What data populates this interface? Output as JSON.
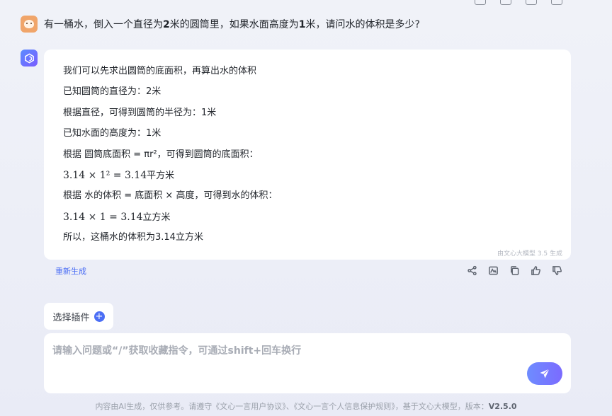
{
  "question": {
    "pre": "有一桶水，倒入一个直径为",
    "n1": "2",
    "mid": "米的圆筒里，如果水面高度为",
    "n2": "1",
    "post": "米，请问水的体积是多少?"
  },
  "answer": {
    "line1": "我们可以先求出圆筒的底面积，再算出水的体积",
    "line2": "已知圆筒的直径为：2米",
    "line3": "根据直径，可得到圆筒的半径为：1米",
    "line4": "已知水面的高度为：1米",
    "line5": "根据 圆筒底面积 = πr²，可得到圆筒的底面积：",
    "formula1": "3.14 × 1² = 3.14",
    "formula1_unit": "平方米",
    "line6": "根据 水的体积 = 底面积 × 高度，可得到水的体积：",
    "formula2": "3.14 × 1 = 3.14",
    "formula2_unit": "立方米",
    "line7": "所以，这桶水的体积为3.14立方米",
    "watermark": "由文心大模型 3.5 生成"
  },
  "regenerate_label": "重新生成",
  "icons": [
    "share-icon",
    "image-icon",
    "copy-icon",
    "thumbs-up-icon",
    "thumbs-down-icon"
  ],
  "plugin_label": "选择插件",
  "input_placeholder": "请输入问题或“/”获取收藏指令，可通过shift+回车换行",
  "footer": {
    "text": "内容由AI生成，仅供参考。请遵守《文心一言用户协议》、《文心一言个人信息保护规则》，基于文心大模型，版本：",
    "version": "V2.5.0"
  },
  "colors": {
    "accent": "#4b6ef5",
    "send_button": "#7b6bff",
    "background": "#eceef7"
  }
}
